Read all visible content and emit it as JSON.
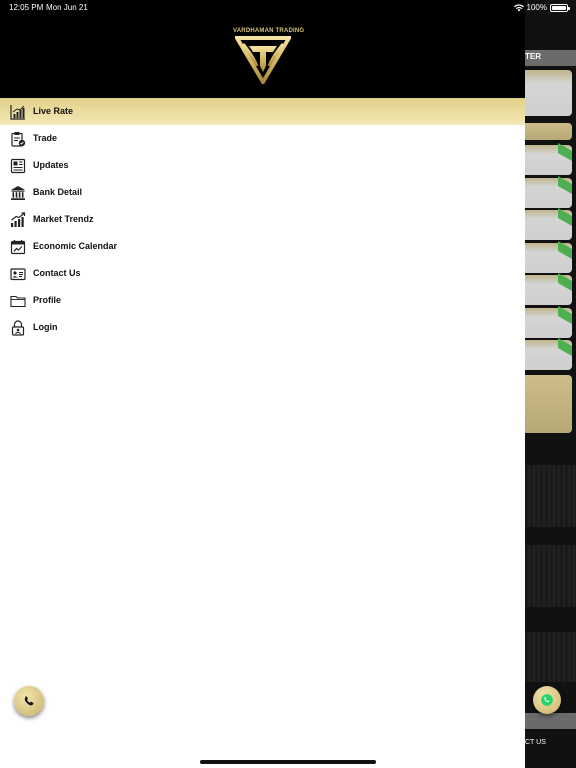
{
  "status_bar": {
    "time": "12:05 PM",
    "date": "Mon Jun 21",
    "battery": "100%",
    "battery_level": 1.0
  },
  "brand": {
    "name": "VARDHAMAN TRADING",
    "gold": "#d8c27a",
    "active_bg": "#e9da9c"
  },
  "menu": {
    "items": [
      {
        "label": "Live Rate",
        "icon": "chart-bars-icon",
        "active": true
      },
      {
        "label": "Trade",
        "icon": "clipboard-icon",
        "active": false
      },
      {
        "label": "Updates",
        "icon": "newspaper-icon",
        "active": false
      },
      {
        "label": "Bank Detail",
        "icon": "bank-icon",
        "active": false
      },
      {
        "label": "Market Trendz",
        "icon": "trend-up-icon",
        "active": false
      },
      {
        "label": "Economic Calendar",
        "icon": "calendar-icon",
        "active": false
      },
      {
        "label": "Contact Us",
        "icon": "contact-card-icon",
        "active": false
      },
      {
        "label": "Profile",
        "icon": "folder-icon",
        "active": false
      },
      {
        "label": "Login",
        "icon": "lock-user-icon",
        "active": false
      }
    ]
  },
  "background": {
    "header_fragment": "TER",
    "footer_fragment": "CT US"
  }
}
